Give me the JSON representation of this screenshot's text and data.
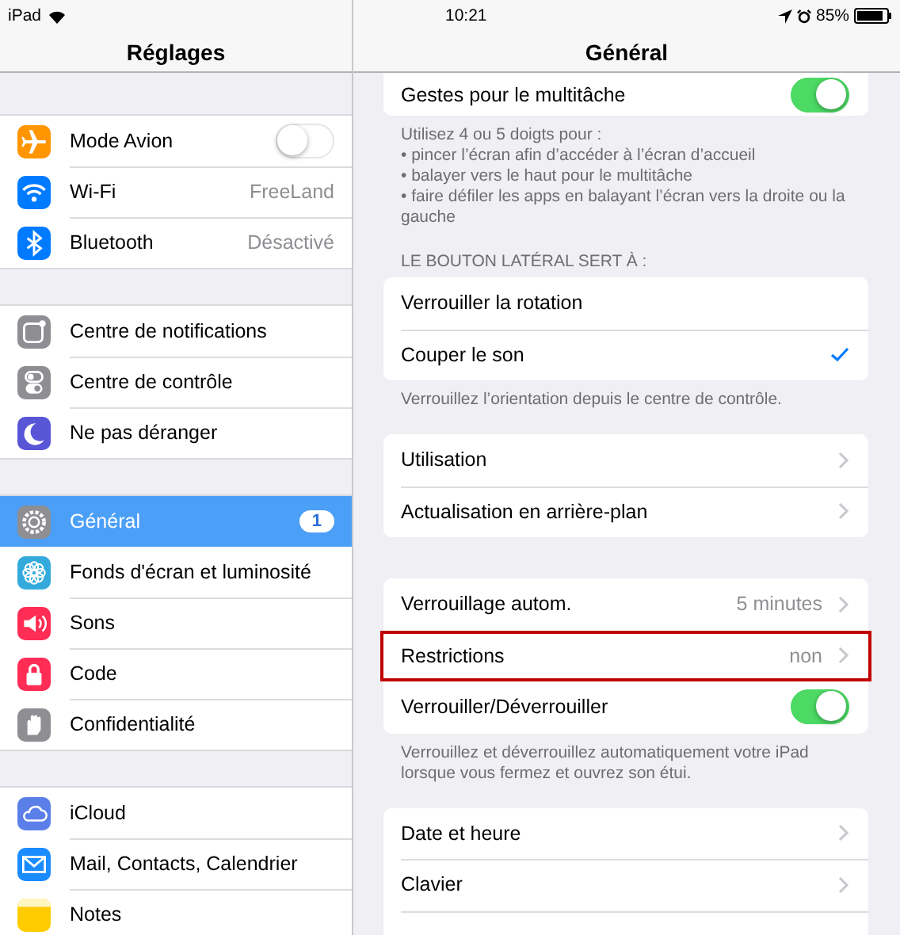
{
  "status_bar": {
    "device": "iPad",
    "time": "10:21",
    "battery": "85%"
  },
  "sidebar": {
    "title": "Réglages",
    "groups": [
      [
        {
          "label": "Mode Avion",
          "kind": "toggle",
          "on": false,
          "color": "#ff9500",
          "selected": false
        },
        {
          "label": "Wi-Fi",
          "kind": "value",
          "value": "FreeLand",
          "color": "#007aff",
          "selected": false
        },
        {
          "label": "Bluetooth",
          "kind": "value",
          "value": "Désactivé",
          "color": "#007aff",
          "selected": false
        }
      ],
      [
        {
          "label": "Centre de notifications",
          "kind": "plain",
          "color": "#8e8e93",
          "selected": false
        },
        {
          "label": "Centre de contrôle",
          "kind": "plain",
          "color": "#8e8e93",
          "selected": false
        },
        {
          "label": "Ne pas déranger",
          "kind": "plain",
          "color": "#5856d6",
          "selected": false
        }
      ],
      [
        {
          "label": "Général",
          "kind": "badge",
          "badge": "1",
          "color": "#8e8e93",
          "selected": true
        },
        {
          "label": "Fonds d'écran et luminosité",
          "kind": "plain",
          "color": "#34aadc",
          "selected": false
        },
        {
          "label": "Sons",
          "kind": "plain",
          "color": "#ff2d55",
          "selected": false
        },
        {
          "label": "Code",
          "kind": "plain",
          "color": "#ff2d55",
          "selected": false
        },
        {
          "label": "Confidentialité",
          "kind": "plain",
          "color": "#8e8e93",
          "selected": false
        }
      ],
      [
        {
          "label": "iCloud",
          "kind": "plain",
          "color": "#5b7fe8",
          "selected": false
        },
        {
          "label": "Mail, Contacts, Calendrier",
          "kind": "plain",
          "color": "#1a8cff",
          "selected": false
        },
        {
          "label": "Notes",
          "kind": "plain",
          "color": "#ffcc00",
          "selected": false
        }
      ]
    ]
  },
  "detail": {
    "title": "Général",
    "sections": [
      {
        "rows": [
          {
            "label": "Gestes pour le multitâche",
            "kind": "toggle",
            "on": true,
            "highlighted": false
          }
        ],
        "footer": [
          "Utilisez 4 ou 5 doigts pour :",
          "• pincer l’écran afin d’accéder à l’écran d’accueil",
          "• balayer vers le haut pour le multitâche",
          "• faire défiler les apps en balayant l’écran vers la droite ou la gauche"
        ]
      },
      {
        "header": "LE BOUTON LATÉRAL SERT À :",
        "rows": [
          {
            "label": "Verrouiller la rotation",
            "kind": "check",
            "checked": false,
            "highlighted": false
          },
          {
            "label": "Couper le son",
            "kind": "check",
            "checked": true,
            "highlighted": false
          }
        ],
        "footer": [
          "Verrouillez l’orientation depuis le centre de contrôle."
        ]
      },
      {
        "rows": [
          {
            "label": "Utilisation",
            "kind": "disclosure",
            "highlighted": false
          },
          {
            "label": "Actualisation en arrière-plan",
            "kind": "disclosure",
            "highlighted": false
          }
        ]
      },
      {
        "rows": [
          {
            "label": "Verrouillage autom.",
            "kind": "disclosure",
            "value": "5 minutes",
            "highlighted": false
          },
          {
            "label": "Restrictions",
            "kind": "disclosure",
            "value": "non",
            "highlighted": true
          },
          {
            "label": "Verrouiller/Déverrouiller",
            "kind": "toggle",
            "on": true,
            "highlighted": false
          }
        ],
        "footer": [
          "Verrouillez et déverrouillez automatiquement votre iPad lorsque vous fermez et ouvrez son étui."
        ]
      },
      {
        "rows": [
          {
            "label": "Date et heure",
            "kind": "disclosure",
            "highlighted": false
          },
          {
            "label": "Clavier",
            "kind": "disclosure",
            "highlighted": false
          }
        ]
      }
    ]
  }
}
